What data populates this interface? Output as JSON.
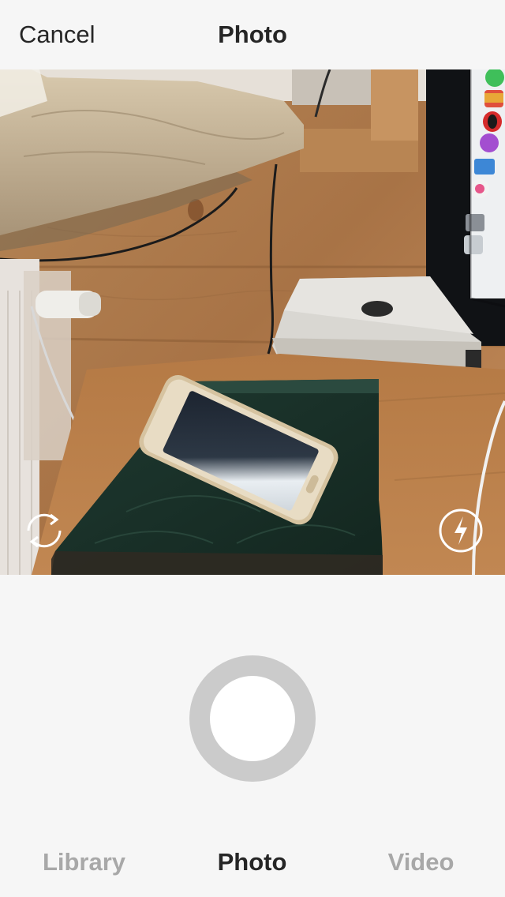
{
  "header": {
    "cancel_label": "Cancel",
    "title": "Photo"
  },
  "camera": {
    "switch_icon": "switch-camera-icon",
    "flash_icon": "flash-icon"
  },
  "shutter": {
    "icon": "shutter-button"
  },
  "tabs": [
    {
      "label": "Library",
      "active": false
    },
    {
      "label": "Photo",
      "active": true
    },
    {
      "label": "Video",
      "active": false
    }
  ],
  "colors": {
    "background": "#f6f6f6",
    "text": "#262626",
    "inactive_tab": "#a8a8a8",
    "shutter_ring": "#cbcbcb"
  }
}
